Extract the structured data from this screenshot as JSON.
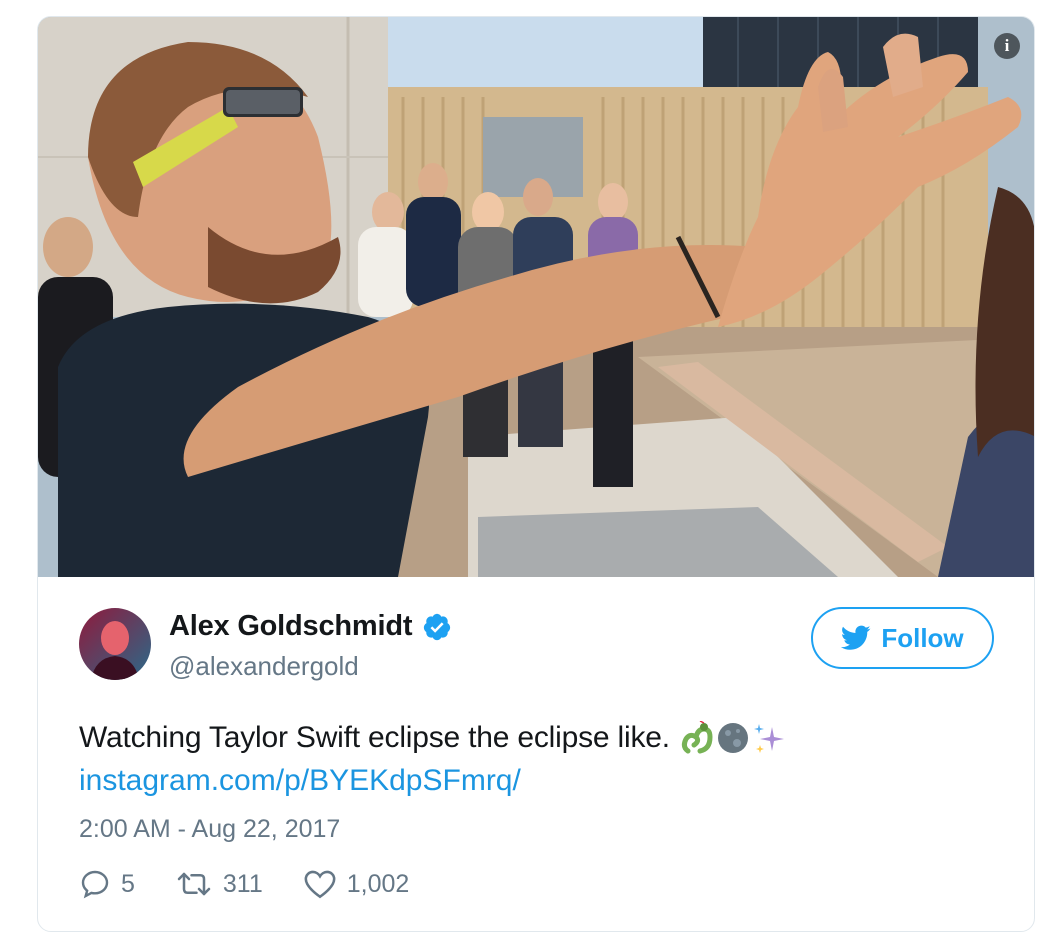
{
  "tweet": {
    "author": {
      "display_name": "Alex Goldschmidt",
      "handle": "@alexandergold",
      "verified": true
    },
    "follow_label": "Follow",
    "text": "Watching Taylor Swift eclipse the eclipse like.",
    "emojis": [
      "snake",
      "new-moon",
      "sparkles"
    ],
    "link": "instagram.com/p/BYEKdpSFmrq/",
    "timestamp": "2:00 AM - Aug 22, 2017",
    "stats": {
      "replies": "5",
      "retweets": "311",
      "likes": "1,002"
    }
  },
  "icons": {
    "info": "info-icon",
    "verified": "verified-badge-icon",
    "bird": "twitter-bird-icon",
    "reply": "reply-icon",
    "retweet": "retweet-icon",
    "like": "heart-icon"
  },
  "colors": {
    "brand_blue": "#1da1f2",
    "link_blue": "#1b95e0",
    "text_primary": "#14171a",
    "text_secondary": "#657786",
    "border": "#e1e8ed"
  }
}
